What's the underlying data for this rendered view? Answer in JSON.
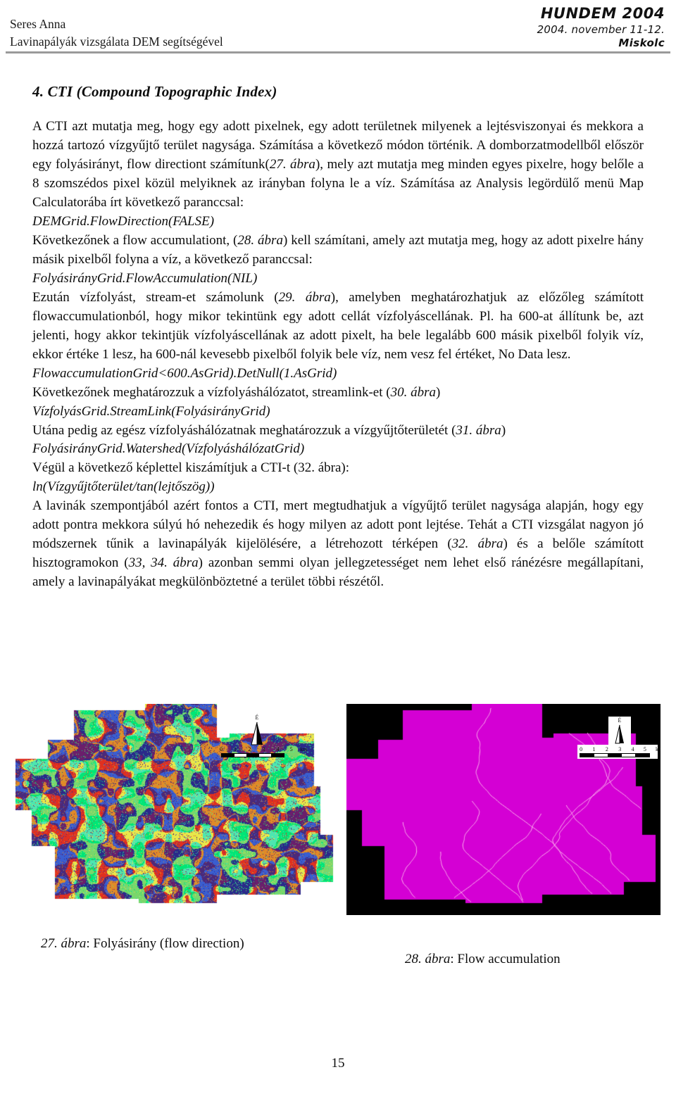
{
  "header": {
    "author": "Seres Anna",
    "subtitle": "Lavinapályák vizsgálata DEM segítségével",
    "conference": "HUNDEM 2004",
    "date": "2004. november 11-12.",
    "place": "Miskolc"
  },
  "section": {
    "title": "4. CTI (Compound Topographic Index)"
  },
  "paragraphs": {
    "p1": "A CTI azt mutatja meg, hogy egy adott pixelnek, egy adott területnek milyenek a lejtésviszonyai és mekkora a hozzá tartozó vízgyűjtő terület nagysága. Számítása a következő módon történik. A domborzatmodellből először egy folyásirányt, flow directiont számítunk(",
    "p1_fig": "27. ábra",
    "p1b": "), mely azt mutatja meg minden egyes pixelre, hogy belőle a 8 szomszédos pixel közül melyiknek az irányban folyna le a víz. Számítása az Analysis legördülő menü Map Calculatorába írt következő paranccsal:",
    "code1": "DEMGrid.FlowDirection(FALSE)",
    "p2a": "Következőnek a flow accumulationt, (",
    "p2_fig": "28. ábra",
    "p2b": ") kell számítani, amely azt mutatja meg, hogy az adott pixelre hány másik pixelből folyna a víz, a következő paranccsal:",
    "code2": "FolyásirányGrid.FlowAccumulation(NIL)",
    "p3a": "Ezután vízfolyást, stream-et számolunk (",
    "p3_fig": "29. ábra",
    "p3b": "), amelyben meghatározhatjuk az előzőleg számított flowaccumulationból, hogy mikor tekintünk egy adott cellát vízfolyáscellának. Pl. ha 600-at állítunk be, azt jelenti, hogy akkor tekintjük vízfolyáscellának az adott pixelt, ha bele legalább 600 másik pixelből folyik víz, ekkor értéke 1 lesz, ha 600-nál kevesebb pixelből folyik bele víz, nem vesz fel értéket, No Data lesz.",
    "code3": "FlowaccumulationGrid<600.AsGrid).DetNull(1.AsGrid)",
    "p4a": "Következőnek meghatározzuk a vízfolyáshálózatot, streamlink-et (",
    "p4_fig": "30. ábra",
    "p4b": ")",
    "code4": "VízfolyásGrid.StreamLink(FolyásirányGrid)",
    "p5a": "Utána pedig az egész vízfolyáshálózatnak meghatározzuk a vízgyűjtőterületét (",
    "p5_fig": "31. ábra",
    "p5b": ")",
    "code5": "FolyásirányGrid.Watershed(VízfolyáshálózatGrid)",
    "p6": "Végül a következő képlettel kiszámítjuk a CTI-t (32. ábra):",
    "code6": "ln(Vízgyűjtőterület/tan(lejtőszög))",
    "p7a": "A lavinák szempontjából azért fontos a CTI, mert megtudhatjuk a vígyűjtő terület nagysága alapján, hogy egy adott pontra mekkora súlyú hó nehezedik és hogy milyen az adott pont lejtése. Tehát a CTI vizsgálat nagyon jó módszernek tűnik a lavinapályák kijelölésére, a létrehozott térképen (",
    "p7_fig1": "32. ábra",
    "p7b": ") és a belőle számított hisztogramokon (",
    "p7_fig2": "33, 34. ábra",
    "p7c": ") azonban semmi olyan jellegzetességet nem lehet első ránézésre megállapítani, amely a lavinapályákat megkülönböztetné a terület többi részétől."
  },
  "figures": {
    "left": {
      "caption_num": "27. ábra",
      "caption_text": ": Folyásirány (flow direction)",
      "north_label": "É",
      "scale_ticks": [
        "0",
        "1",
        "2",
        "3",
        "4",
        "5"
      ],
      "scale_unit": "km",
      "palette": [
        "#00e676",
        "#4de6b0",
        "#e8e84a",
        "#e03020",
        "#4a2a7a",
        "#3a5ed0",
        "#e08a28",
        "#6b1f6b",
        "#2a2a8a",
        "#7ad66b"
      ],
      "background": "#ffffff"
    },
    "right": {
      "caption_num": "28. ábra",
      "caption_text": ": Flow accumulation",
      "north_label": "É",
      "scale_ticks": [
        "0",
        "1",
        "2",
        "3",
        "4",
        "5"
      ],
      "scale_unit": "km",
      "fill_color": "#d400d4",
      "stream_color": "#ffb6f0",
      "background": "#000000"
    }
  },
  "footer": {
    "page_number": "15"
  }
}
